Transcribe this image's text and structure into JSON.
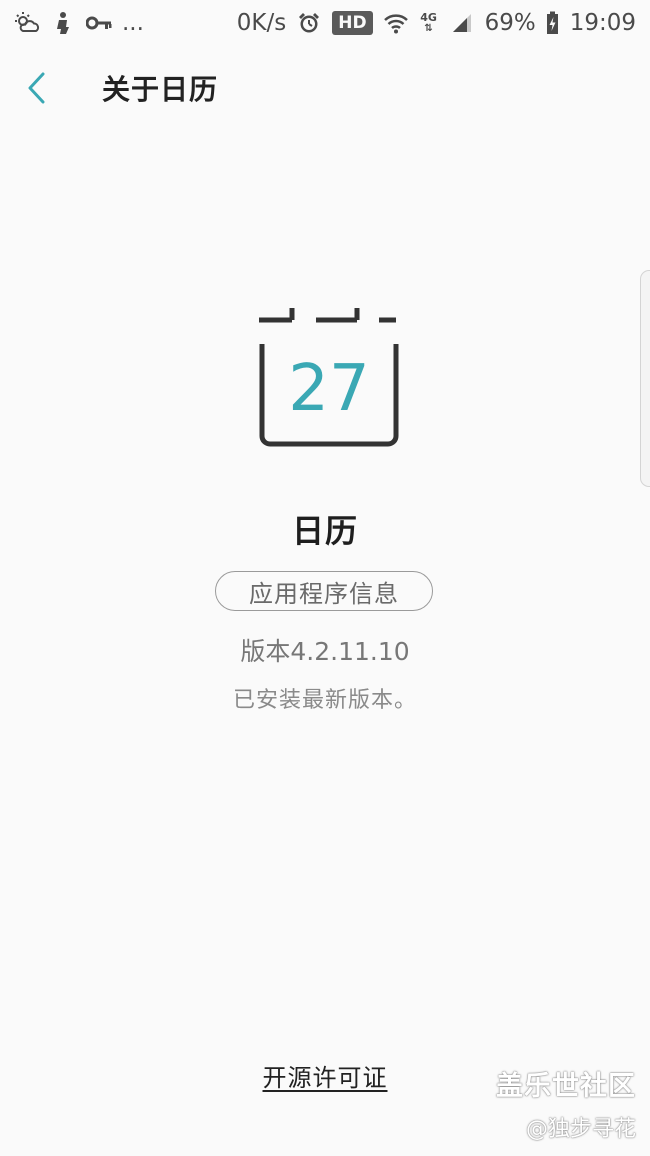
{
  "status_bar": {
    "left_icons": [
      "weather-icon",
      "notification-icon",
      "key-icon"
    ],
    "more": "...",
    "net_speed": "0K/s",
    "hd_badge": "HD",
    "network_type": "4G",
    "battery_percent": "69%",
    "time": "19:09"
  },
  "header": {
    "title": "关于日历"
  },
  "app_icon": {
    "day_number": "27",
    "accent_color": "#3aa8b4"
  },
  "app": {
    "name": "日历",
    "info_button_label": "应用程序信息",
    "version": "版本4.2.11.10",
    "update_status": "已安装最新版本。"
  },
  "footer": {
    "license_label": "开源许可证"
  },
  "watermark": {
    "line1": "盖乐世社区",
    "line2": "@独步寻花"
  }
}
